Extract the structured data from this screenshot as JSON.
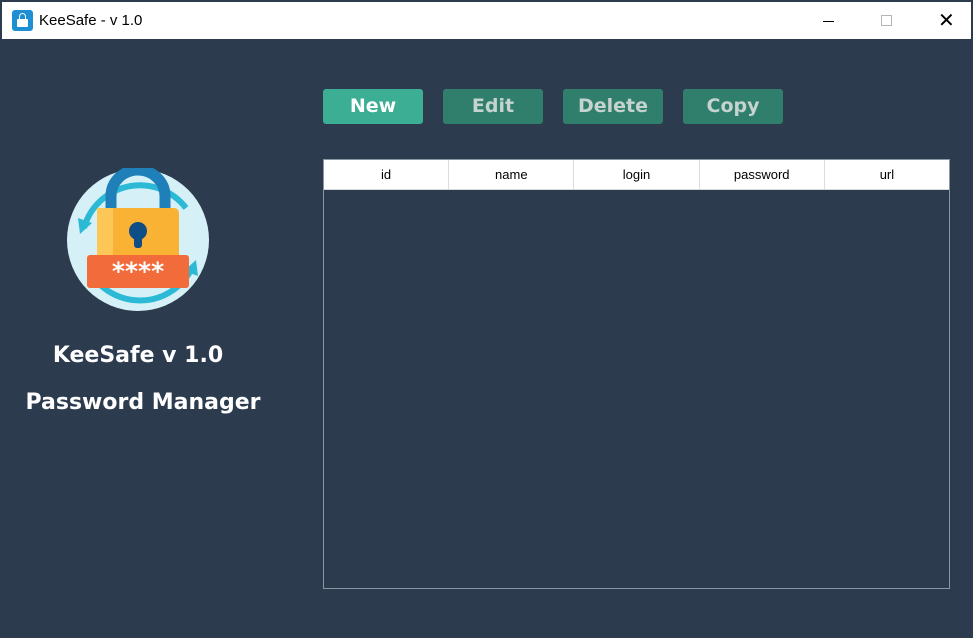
{
  "window": {
    "title": "KeeSafe - v 1.0",
    "controls": {
      "minimize": "minimize",
      "maximize": "maximize",
      "close": "✕"
    }
  },
  "toolbar": {
    "new_label": "New",
    "edit_label": "Edit",
    "delete_label": "Delete",
    "copy_label": "Copy"
  },
  "sidebar": {
    "logo_icon": "padlock-password-icon",
    "logo_text": "****",
    "app_name": "KeeSafe v 1.0",
    "subtitle": "Password Manager"
  },
  "table": {
    "columns": [
      "id",
      "name",
      "login",
      "password",
      "url"
    ],
    "rows": []
  },
  "colors": {
    "background": "#2c3b4e",
    "primary_button": "#3cae94",
    "secondary_button": "#2f7f6c",
    "lock_body": "#f9b233",
    "lock_shackle": "#1f7fb8",
    "password_bar": "#f26b3a"
  }
}
